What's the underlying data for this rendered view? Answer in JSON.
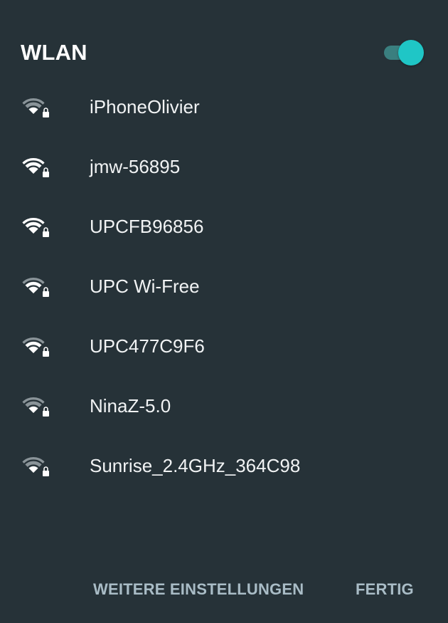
{
  "header": {
    "title": "WLAN",
    "toggle_on": true
  },
  "colors": {
    "background": "#263238",
    "accent": "#1fc6c6",
    "toggle_track": "#3a7f7f",
    "text": "#f1f3f4",
    "button_text": "#a9bcc6",
    "wifi_strong": "#ffffff",
    "wifi_weak": "#8a9499"
  },
  "networks": [
    {
      "name": "iPhoneOlivier",
      "icon": "wifi-locked-icon",
      "signal_bars": 1
    },
    {
      "name": "jmw-56895",
      "icon": "wifi-locked-icon",
      "signal_bars": 3
    },
    {
      "name": "UPCFB96856",
      "icon": "wifi-locked-icon",
      "signal_bars": 3
    },
    {
      "name": "UPC Wi-Free",
      "icon": "wifi-locked-icon",
      "signal_bars": 2
    },
    {
      "name": "UPC477C9F6",
      "icon": "wifi-locked-icon",
      "signal_bars": 2
    },
    {
      "name": "NinaZ-5.0",
      "icon": "wifi-locked-icon",
      "signal_bars": 1
    },
    {
      "name": "Sunrise_2.4GHz_364C98",
      "icon": "wifi-locked-icon",
      "signal_bars": 1
    }
  ],
  "footer": {
    "more_settings_label": "WEITERE EINSTELLUNGEN",
    "done_label": "FERTIG"
  }
}
